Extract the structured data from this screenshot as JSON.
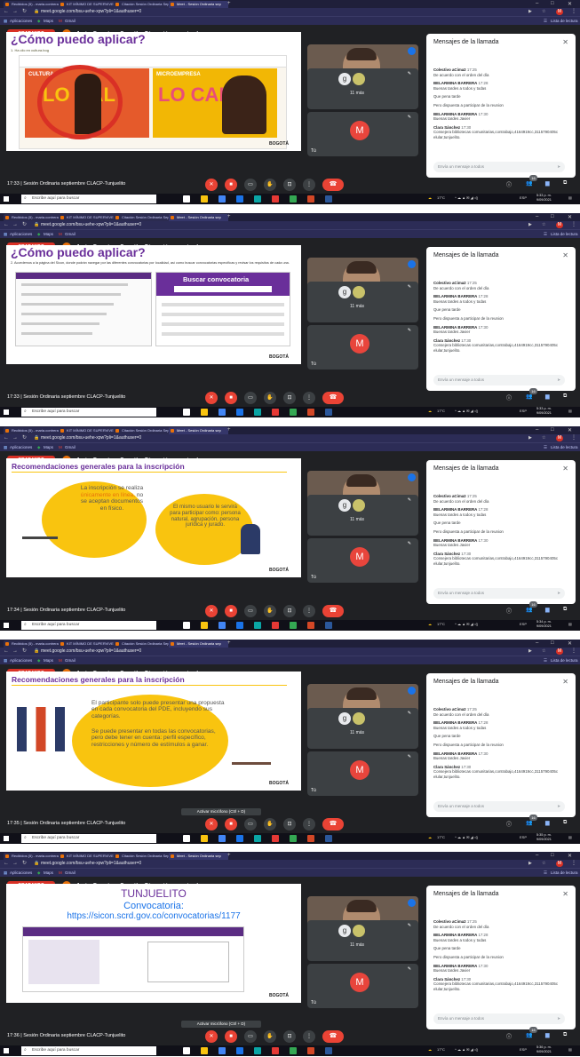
{
  "browser": {
    "tabs": [
      {
        "label": "Recibidos (5) - maria.contreras@"
      },
      {
        "label": "KIT MÍNIMO DE SUPERVIVENCIA"
      },
      {
        "label": "Citación Sesión Ordinaria Septiem"
      },
      {
        "label": "Meet - Sesión Ordinaria sep"
      }
    ],
    "url": "meet.google.com/bsu-uehe-xpw?pli=1&authuser=0",
    "bookmarks": [
      "Aplicaciones",
      "Maps",
      "Gmail"
    ],
    "reading_list": "Lista de lectura",
    "profile_letter": "M"
  },
  "meet": {
    "recording_label": "GRABANDO",
    "presenter_text": "Javier Francisco González Díaz está presentando",
    "tile_name": "Javier Francisco González Díaz",
    "tile_g": "g",
    "more_count": "11 más",
    "self_initial": "M",
    "self_label": "Tú",
    "meeting_title": "Sesión Ordinaria septiembre CLACP-Tunjuelito",
    "participants_badge": "16",
    "mic_hint": "Activar micrófono (Ctrl + D)"
  },
  "chat": {
    "title": "Mensajes de la llamada",
    "input_placeholder": "Envía un mensaje a todos",
    "messages": [
      {
        "sender": "Colectivo aCima2",
        "time": "17:25",
        "text": "De acuerdo con el orden del día"
      },
      {
        "sender": "BELARMINA BARRERA",
        "time": "17:28",
        "text": "Buenas tardes a todos y todas"
      },
      {
        "sender": "",
        "time": "",
        "text": "Que pena tarde"
      },
      {
        "sender": "",
        "time": "",
        "text": "Pero dispuesta a participar de la reunion"
      },
      {
        "sender": "BELARMINA BARRERA",
        "time": "17:30",
        "text": "Buenas tardes Javier"
      },
      {
        "sender": "Clara Sánchez",
        "time": "17:30",
        "text": "Consejera bibliotecas comunitarias,contrabajo,4164919cc,3115790405c elular,tunjuelito."
      }
    ]
  },
  "taskbar": {
    "search_placeholder": "Escribe aquí para buscar",
    "weather": "17°C",
    "lang": "ESP",
    "date": "9/09/2021"
  },
  "frames": [
    {
      "time": "17:33",
      "clock": "5:33 p. m.",
      "slide_title": "¿Cómo puedo aplicar?",
      "slide_sub": "1. Ha clic en cultura.bog",
      "slide_variant": "cultura",
      "slide_lines": [
        "CULTURA",
        "LO CAL",
        "MICROEMPRESA",
        "LO CAL",
        "BOGOTÁ"
      ]
    },
    {
      "time": "17:33",
      "clock": "5:33 p. m.",
      "slide_title": "¿Cómo puedo aplicar?",
      "slide_sub": "2. Accedemos a la página del Sicon, donde podrán navegar por las diferentes convocatorias por localidad, así como buscar convocatorias específicas y revisar los requisitos de cada una.",
      "slide_variant": "sicon",
      "slide_lines": [
        "Buscar convocatoria",
        "BOGOTÁ"
      ]
    },
    {
      "time": "17:34",
      "clock": "5:34 p. m.",
      "slide_title": "Recomendaciones generales para la inscripción",
      "slide_sub": "",
      "slide_variant": "reco1",
      "slide_lines": [
        "La inscripción se realiza",
        "únicamente en línea,",
        "no se aceptan documentos en físico.",
        "El mismo usuario le servirá para participar como: persona natural, agrupación, persona jurídica y jurado.",
        "BOGOTÁ"
      ]
    },
    {
      "time": "17:35",
      "clock": "5:35 p. m.",
      "slide_title": "Recomendaciones generales para la inscripción",
      "slide_sub": "",
      "slide_variant": "reco2",
      "slide_lines": [
        "El participante solo puede presentar una propuesta en cada convocatoria del PDE, incluyendo sus categorías.",
        "Se puede presentar en todas las convocatorias, pero debe tener en cuenta: perfil específico, restricciones y número de estímulos a ganar.",
        "BOGOTÁ"
      ]
    },
    {
      "time": "17:36",
      "clock": "5:36 p. m.",
      "slide_title": "TUNJUELITO",
      "slide_sub": "Convocatoria:",
      "slide_variant": "tunjuelito",
      "slide_lines": [
        "https://sicon.scrd.gov.co/convocatorias/1177",
        "BOGOTÁ"
      ]
    }
  ],
  "colors": {
    "accent_red": "#ea4335",
    "purple": "#6a2f9a",
    "yellow": "#f9c40f",
    "meet_bg": "#202124"
  }
}
